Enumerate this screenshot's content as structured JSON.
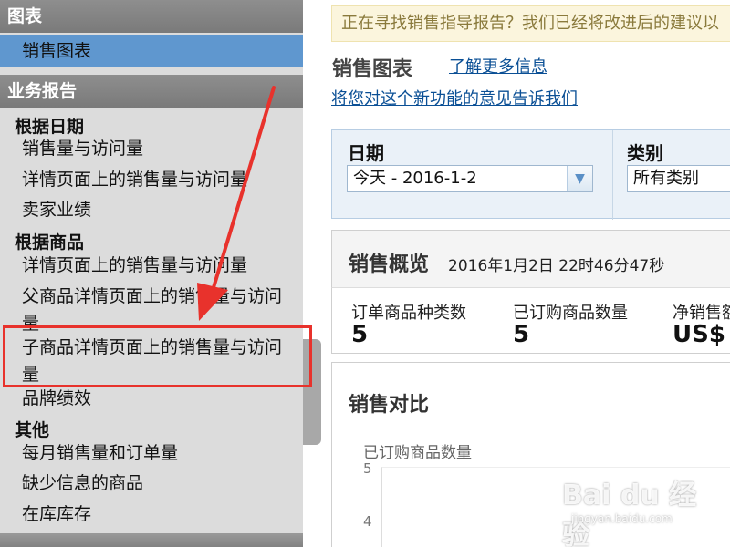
{
  "sidebar": {
    "charts_header": "图表",
    "charts_item": "销售图表",
    "reports_header": "业务报告",
    "group_by_date": "根据日期",
    "by_date_items": [
      "销售量与访问量",
      "详情页面上的销售量与访问量",
      "卖家业绩"
    ],
    "group_by_product": "根据商品",
    "by_product_items": [
      "详情页面上的销售量与访问量",
      "父商品详情页面上的销售量与访问量",
      "子商品详情页面上的销售量与访问量",
      "品牌绩效"
    ],
    "group_other": "其他",
    "other_items": [
      "每月销售量和订单量",
      "缺少信息的商品",
      "在库库存"
    ]
  },
  "notice": "正在寻找销售指导报告？我们已经将改进后的建议以",
  "header": {
    "title": "销售图表",
    "learn_more": "了解更多信息",
    "feedback": "将您对这个新功能的意见告诉我们"
  },
  "filters": {
    "date_label": "日期",
    "date_value": "今天 - 2016-1-2",
    "category_label": "类别",
    "category_value": "所有类别"
  },
  "summary": {
    "title": "销售概览",
    "timestamp": "2016年1月2日 22时46分47秒",
    "metrics": [
      {
        "label": "订单商品种类数",
        "value": "5"
      },
      {
        "label": "已订购商品数量",
        "value": "5"
      },
      {
        "label": "净销售额",
        "value": "US$"
      }
    ]
  },
  "comparison": {
    "title": "销售对比",
    "axis_title": "已订购商品数量",
    "ticks": [
      "5",
      "4"
    ]
  },
  "watermark": {
    "logo": "Bai du 经验",
    "url": "jingyan.baidu.com"
  },
  "colors": {
    "highlight": "#e8322c",
    "active_nav": "#5f97cf",
    "link": "#0a4f95"
  }
}
